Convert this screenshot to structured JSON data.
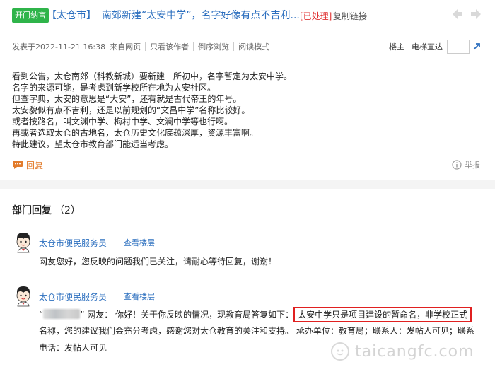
{
  "header": {
    "badge": "开门纳言",
    "city": "【太仓市】",
    "subject": "南郊新建“太安中学”，名字好像有点不吉利...",
    "status": "[已处理]",
    "copy_link": "复制链接"
  },
  "meta": {
    "posted": "发表于2022-11-21 16:38",
    "source": "来自网页",
    "author_only": "只看该作者",
    "reverse": "倒序浏览",
    "read_mode": "阅读模式",
    "owner": "楼主",
    "elevator": "电梯直达"
  },
  "post": {
    "lines": [
      "看到公告，太仓南郊（科教新城）要新建一所初中，名字暂定为太安中学。",
      "名字的来源可能，是考虑到新学校所在地为太安社区。",
      "但查字典，太安的意思是“大安”，还有就是古代帝王的年号。",
      "太安貌似有点不吉利，还是以前规划的“文昌中学”名称比较好。",
      "或者按路名，叫文渊中学、梅村中学、文澜中学等也行啊。",
      "再或者选取太仓的古地名，太仓历史文化底蕴深厚，资源丰富啊。",
      "特此建议，望太仓市教育部门能适当考虑。"
    ],
    "reply": "回复",
    "report": "举报"
  },
  "dept": {
    "title": "部门回复",
    "count": "（2）",
    "replies": [
      {
        "name": "太仓市便民服务员",
        "view": "查看楼层",
        "text": "网友您好，您反映的问题我们已关注，请耐心等待回复，谢谢！"
      },
      {
        "name": "太仓市便民服务员",
        "view": "查看楼层",
        "quote_open": "“",
        "quote_close": "”",
        "line1_a": "网友：  你好！关于你反映的情况，现教育局答复如下：",
        "line1_hl": "太安中学只是项目建设的暂命名，非学校正式",
        "line2": "名称，您的建议我们会充分考虑，感谢您对太仓教育的关注和支持。  承办单位：教育局；联系人：发帖人可见；联系",
        "line3": "电话：发帖人可见"
      }
    ]
  },
  "watermark": "taicangfc.com",
  "colors": {
    "badge_green": "#2fb44a",
    "link_blue": "#2c6fbf",
    "status_red": "#e02f2f",
    "reply_orange": "#e27b2b",
    "highlight_red": "#e02020"
  }
}
